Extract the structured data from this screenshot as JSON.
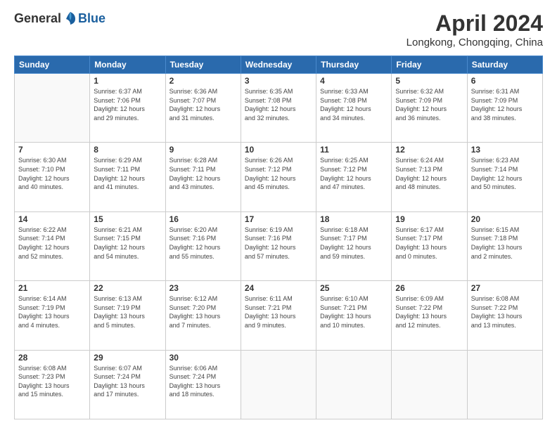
{
  "header": {
    "logo_general": "General",
    "logo_blue": "Blue",
    "title": "April 2024",
    "location": "Longkong, Chongqing, China"
  },
  "days_of_week": [
    "Sunday",
    "Monday",
    "Tuesday",
    "Wednesday",
    "Thursday",
    "Friday",
    "Saturday"
  ],
  "weeks": [
    [
      {
        "day": "",
        "info": ""
      },
      {
        "day": "1",
        "info": "Sunrise: 6:37 AM\nSunset: 7:06 PM\nDaylight: 12 hours\nand 29 minutes."
      },
      {
        "day": "2",
        "info": "Sunrise: 6:36 AM\nSunset: 7:07 PM\nDaylight: 12 hours\nand 31 minutes."
      },
      {
        "day": "3",
        "info": "Sunrise: 6:35 AM\nSunset: 7:08 PM\nDaylight: 12 hours\nand 32 minutes."
      },
      {
        "day": "4",
        "info": "Sunrise: 6:33 AM\nSunset: 7:08 PM\nDaylight: 12 hours\nand 34 minutes."
      },
      {
        "day": "5",
        "info": "Sunrise: 6:32 AM\nSunset: 7:09 PM\nDaylight: 12 hours\nand 36 minutes."
      },
      {
        "day": "6",
        "info": "Sunrise: 6:31 AM\nSunset: 7:09 PM\nDaylight: 12 hours\nand 38 minutes."
      }
    ],
    [
      {
        "day": "7",
        "info": "Sunrise: 6:30 AM\nSunset: 7:10 PM\nDaylight: 12 hours\nand 40 minutes."
      },
      {
        "day": "8",
        "info": "Sunrise: 6:29 AM\nSunset: 7:11 PM\nDaylight: 12 hours\nand 41 minutes."
      },
      {
        "day": "9",
        "info": "Sunrise: 6:28 AM\nSunset: 7:11 PM\nDaylight: 12 hours\nand 43 minutes."
      },
      {
        "day": "10",
        "info": "Sunrise: 6:26 AM\nSunset: 7:12 PM\nDaylight: 12 hours\nand 45 minutes."
      },
      {
        "day": "11",
        "info": "Sunrise: 6:25 AM\nSunset: 7:12 PM\nDaylight: 12 hours\nand 47 minutes."
      },
      {
        "day": "12",
        "info": "Sunrise: 6:24 AM\nSunset: 7:13 PM\nDaylight: 12 hours\nand 48 minutes."
      },
      {
        "day": "13",
        "info": "Sunrise: 6:23 AM\nSunset: 7:14 PM\nDaylight: 12 hours\nand 50 minutes."
      }
    ],
    [
      {
        "day": "14",
        "info": "Sunrise: 6:22 AM\nSunset: 7:14 PM\nDaylight: 12 hours\nand 52 minutes."
      },
      {
        "day": "15",
        "info": "Sunrise: 6:21 AM\nSunset: 7:15 PM\nDaylight: 12 hours\nand 54 minutes."
      },
      {
        "day": "16",
        "info": "Sunrise: 6:20 AM\nSunset: 7:16 PM\nDaylight: 12 hours\nand 55 minutes."
      },
      {
        "day": "17",
        "info": "Sunrise: 6:19 AM\nSunset: 7:16 PM\nDaylight: 12 hours\nand 57 minutes."
      },
      {
        "day": "18",
        "info": "Sunrise: 6:18 AM\nSunset: 7:17 PM\nDaylight: 12 hours\nand 59 minutes."
      },
      {
        "day": "19",
        "info": "Sunrise: 6:17 AM\nSunset: 7:17 PM\nDaylight: 13 hours\nand 0 minutes."
      },
      {
        "day": "20",
        "info": "Sunrise: 6:15 AM\nSunset: 7:18 PM\nDaylight: 13 hours\nand 2 minutes."
      }
    ],
    [
      {
        "day": "21",
        "info": "Sunrise: 6:14 AM\nSunset: 7:19 PM\nDaylight: 13 hours\nand 4 minutes."
      },
      {
        "day": "22",
        "info": "Sunrise: 6:13 AM\nSunset: 7:19 PM\nDaylight: 13 hours\nand 5 minutes."
      },
      {
        "day": "23",
        "info": "Sunrise: 6:12 AM\nSunset: 7:20 PM\nDaylight: 13 hours\nand 7 minutes."
      },
      {
        "day": "24",
        "info": "Sunrise: 6:11 AM\nSunset: 7:21 PM\nDaylight: 13 hours\nand 9 minutes."
      },
      {
        "day": "25",
        "info": "Sunrise: 6:10 AM\nSunset: 7:21 PM\nDaylight: 13 hours\nand 10 minutes."
      },
      {
        "day": "26",
        "info": "Sunrise: 6:09 AM\nSunset: 7:22 PM\nDaylight: 13 hours\nand 12 minutes."
      },
      {
        "day": "27",
        "info": "Sunrise: 6:08 AM\nSunset: 7:22 PM\nDaylight: 13 hours\nand 13 minutes."
      }
    ],
    [
      {
        "day": "28",
        "info": "Sunrise: 6:08 AM\nSunset: 7:23 PM\nDaylight: 13 hours\nand 15 minutes."
      },
      {
        "day": "29",
        "info": "Sunrise: 6:07 AM\nSunset: 7:24 PM\nDaylight: 13 hours\nand 17 minutes."
      },
      {
        "day": "30",
        "info": "Sunrise: 6:06 AM\nSunset: 7:24 PM\nDaylight: 13 hours\nand 18 minutes."
      },
      {
        "day": "",
        "info": ""
      },
      {
        "day": "",
        "info": ""
      },
      {
        "day": "",
        "info": ""
      },
      {
        "day": "",
        "info": ""
      }
    ]
  ]
}
